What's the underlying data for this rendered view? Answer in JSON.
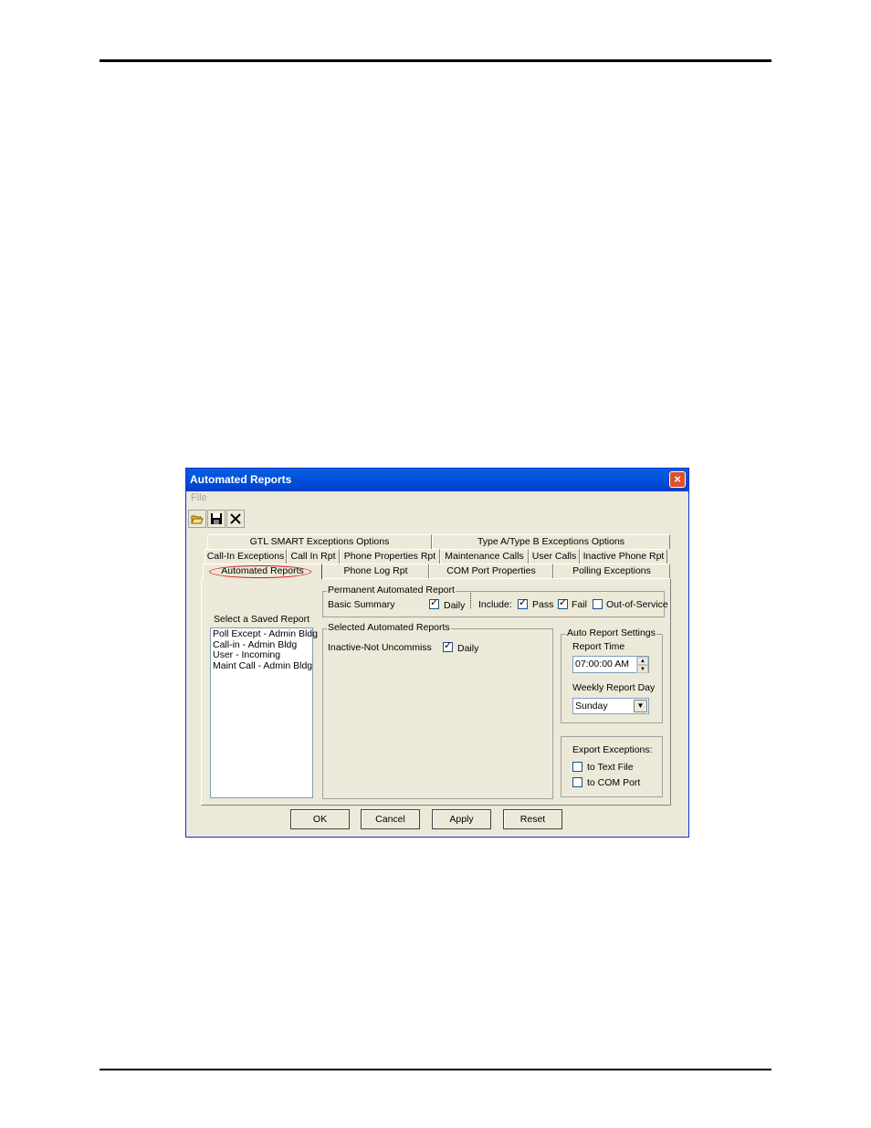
{
  "window": {
    "title": "Automated Reports",
    "close_label": "×"
  },
  "menu": {
    "file": "File"
  },
  "toolbar": {
    "open_icon": "open-folder-icon",
    "save_icon": "save-disk-icon",
    "delete_icon": "delete-x-icon"
  },
  "tabs": {
    "row1": [
      "GTL SMART Exceptions Options",
      "Type A/Type B Exceptions Options"
    ],
    "row2": [
      "Call-In Exceptions",
      "Call In Rpt",
      "Phone Properties Rpt",
      "Maintenance Calls",
      "User Calls",
      "Inactive Phone Rpt"
    ],
    "row3": [
      "Automated Reports",
      "Phone Log Rpt",
      "COM Port Properties",
      "Polling Exceptions"
    ]
  },
  "saved_reports": {
    "label": "Select a Saved Report",
    "items": [
      "Poll Except - Admin Bldg",
      "Call-in - Admin Bldg",
      "User - Incoming",
      "Maint Call - Admin Bldg"
    ]
  },
  "permanent": {
    "title": "Permanent Automated Report",
    "name": "Basic Summary",
    "daily_label": "Daily",
    "include_label": "Include:",
    "pass_label": "Pass",
    "fail_label": "Fail",
    "oos_label": "Out-of-Service",
    "check_mark": "✓"
  },
  "selected": {
    "title": "Selected Automated Reports",
    "name": "Inactive-Not Uncommiss",
    "daily_label": "Daily"
  },
  "auto_settings": {
    "title": "Auto Report Settings",
    "time_label": "Report Time",
    "time_value": "07:00:00 AM",
    "day_label": "Weekly Report Day",
    "day_value": "Sunday"
  },
  "export": {
    "title": "Export Exceptions:",
    "text_file": "to Text File",
    "com_port": "to COM Port"
  },
  "buttons": {
    "ok": "OK",
    "cancel": "Cancel",
    "apply": "Apply",
    "reset": "Reset"
  }
}
